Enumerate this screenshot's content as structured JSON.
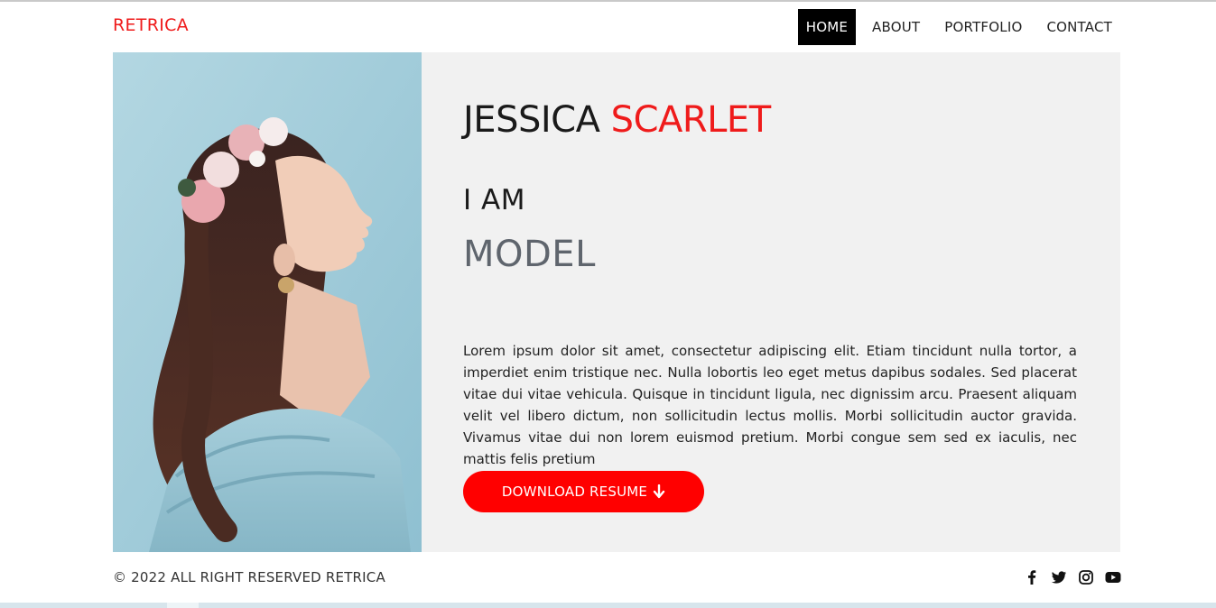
{
  "brand": {
    "name": "RETRICA"
  },
  "nav": {
    "items": [
      {
        "label": "HOME",
        "active": true
      },
      {
        "label": "ABOUT"
      },
      {
        "label": "PORTFOLIO"
      },
      {
        "label": "CONTACT"
      }
    ]
  },
  "hero": {
    "first_name": "JESSICA",
    "last_name": "SCARLET",
    "intro": "I AM",
    "role": "MODEL",
    "bio": "Lorem ipsum dolor sit amet, consectetur adipiscing elit. Etiam tincidunt nulla tortor, a imperdiet enim tristique nec. Nulla lobortis leo eget metus dapibus sodales. Sed placerat vitae dui vitae vehicula. Quisque in tincidunt ligula, nec dignissim arcu. Praesent aliquam velit vel libero dictum, non sollicitudin lectus mollis. Morbi sollicitudin auctor gravida. Vivamus vitae dui non lorem euismod pretium. Morbi congue sem sed ex iaculis, nec mattis felis pretium",
    "resume_button": "DOWNLOAD RESUME",
    "resume_icon": "arrow-down-icon",
    "photo": "woman-with-flower-crown-portrait"
  },
  "footer": {
    "copyright": "© 2022 ALL RIGHT RESERVED RETRICA",
    "social": [
      "facebook-icon",
      "twitter-icon",
      "instagram-icon",
      "youtube-icon"
    ]
  },
  "colors": {
    "accent": "#ef1b1b",
    "button": "#ff0000",
    "panel": "#f1f1f1",
    "role_text": "#5f656d",
    "photo_bg": "#a9d0dc"
  }
}
